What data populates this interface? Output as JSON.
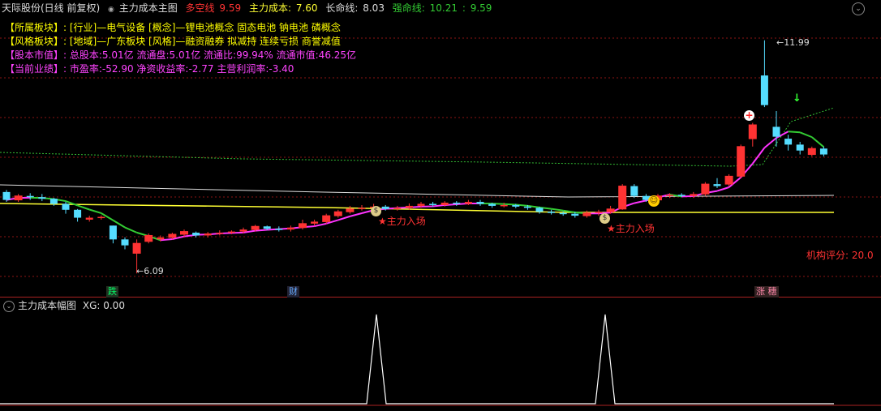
{
  "header": {
    "stock": "天际股份(日线 前复权)",
    "indicator_name": "主力成本主图",
    "multi_label": "多空线",
    "multi_value": "9.59",
    "cost_label": "主力成本:",
    "cost_value": "7.60",
    "life_label": "长命线:",
    "life_value": "8.03",
    "strong_label": "强命线:",
    "strong_value": "10.21",
    "strong_sep": ":",
    "strong_value2": "9.59"
  },
  "info": [
    {
      "label": "【所属板块】:",
      "text": "[行业]—电气设备 [概念]—锂电池概念 固态电池 钠电池 磷概念",
      "color": "#ffff00"
    },
    {
      "label": "【风格板块】:",
      "text": "[地域]—广东板块 [风格]—融资融券 拟减持 连续亏损 商誉减值",
      "color": "#ffff00"
    },
    {
      "label": "【股本市值】:",
      "text": "总股本:5.01亿 流通盘:5.01亿 流通比:99.94% 流通市值:46.25亿",
      "color": "#ff44ff"
    },
    {
      "label": "【当前业绩】:",
      "text": "市盈率:-52.90 净资收益率:-2.77 主营利润率:-3.40",
      "color": "#ff44ff"
    }
  ],
  "annotations": {
    "high": "11.99",
    "low": "6.09",
    "entry1": "主力入场",
    "entry2": "主力入场",
    "score": "机构评分: 20.0"
  },
  "bottom_markers": [
    {
      "text": "跌",
      "color": "#00ff66",
      "bg": "#223322"
    },
    {
      "text": "财",
      "color": "#66aaff",
      "bg": "#222233"
    },
    {
      "text": "涨 穗",
      "color": "#ff88aa",
      "bg": "#332222"
    }
  ],
  "sub_chart": {
    "title": "主力成本幅图",
    "xg_label": "XG:",
    "xg_value": "0.00"
  },
  "colors": {
    "up": "#ff3333",
    "down": "#55ddff",
    "ma_green": "#33cc33",
    "ma_magenta": "#ff33ff",
    "yellow": "#ffff33",
    "white": "#dddddd"
  },
  "chart_data": {
    "type": "candlestick",
    "ylim": [
      5.5,
      12.6
    ],
    "candles": [
      {
        "o": 8.15,
        "c": 7.95,
        "h": 8.2,
        "l": 7.9
      },
      {
        "o": 7.95,
        "c": 8.05,
        "h": 8.1,
        "l": 7.9
      },
      {
        "o": 8.05,
        "c": 8.02,
        "h": 8.12,
        "l": 7.95
      },
      {
        "o": 8.02,
        "c": 7.98,
        "h": 8.1,
        "l": 7.92
      },
      {
        "o": 7.98,
        "c": 7.85,
        "h": 8.0,
        "l": 7.8
      },
      {
        "o": 7.85,
        "c": 7.7,
        "h": 7.9,
        "l": 7.6
      },
      {
        "o": 7.7,
        "c": 7.5,
        "h": 7.72,
        "l": 7.4
      },
      {
        "o": 7.45,
        "c": 7.5,
        "h": 7.55,
        "l": 7.4
      },
      {
        "o": 7.5,
        "c": 7.52,
        "h": 7.56,
        "l": 7.45
      },
      {
        "o": 7.3,
        "c": 6.95,
        "h": 7.3,
        "l": 6.85
      },
      {
        "o": 6.95,
        "c": 6.8,
        "h": 7.0,
        "l": 6.7
      },
      {
        "o": 6.6,
        "c": 6.85,
        "h": 6.95,
        "l": 6.09
      },
      {
        "o": 6.9,
        "c": 7.05,
        "h": 7.1,
        "l": 6.85
      },
      {
        "o": 6.95,
        "c": 7.0,
        "h": 7.05,
        "l": 6.9
      },
      {
        "o": 7.0,
        "c": 7.08,
        "h": 7.12,
        "l": 6.95
      },
      {
        "o": 7.08,
        "c": 7.15,
        "h": 7.2,
        "l": 7.0
      },
      {
        "o": 7.12,
        "c": 7.05,
        "h": 7.15,
        "l": 7.0
      },
      {
        "o": 7.05,
        "c": 7.1,
        "h": 7.14,
        "l": 7.0
      },
      {
        "o": 7.1,
        "c": 7.12,
        "h": 7.18,
        "l": 7.05
      },
      {
        "o": 7.12,
        "c": 7.15,
        "h": 7.18,
        "l": 7.08
      },
      {
        "o": 7.15,
        "c": 7.2,
        "h": 7.25,
        "l": 7.1
      },
      {
        "o": 7.2,
        "c": 7.28,
        "h": 7.32,
        "l": 7.15
      },
      {
        "o": 7.28,
        "c": 7.22,
        "h": 7.3,
        "l": 7.18
      },
      {
        "o": 7.22,
        "c": 7.2,
        "h": 7.28,
        "l": 7.15
      },
      {
        "o": 7.2,
        "c": 7.25,
        "h": 7.3,
        "l": 7.15
      },
      {
        "o": 7.25,
        "c": 7.35,
        "h": 7.45,
        "l": 7.2
      },
      {
        "o": 7.35,
        "c": 7.4,
        "h": 7.45,
        "l": 7.3
      },
      {
        "o": 7.4,
        "c": 7.55,
        "h": 7.6,
        "l": 7.35
      },
      {
        "o": 7.55,
        "c": 7.65,
        "h": 7.7,
        "l": 7.5
      },
      {
        "o": 7.65,
        "c": 7.72,
        "h": 7.8,
        "l": 7.6
      },
      {
        "o": 7.72,
        "c": 7.75,
        "h": 7.82,
        "l": 7.68
      },
      {
        "o": 7.75,
        "c": 7.78,
        "h": 7.85,
        "l": 7.7
      },
      {
        "o": 7.78,
        "c": 7.72,
        "h": 7.82,
        "l": 7.68
      },
      {
        "o": 7.72,
        "c": 7.75,
        "h": 7.8,
        "l": 7.68
      },
      {
        "o": 7.75,
        "c": 7.8,
        "h": 7.86,
        "l": 7.7
      },
      {
        "o": 7.8,
        "c": 7.85,
        "h": 7.9,
        "l": 7.75
      },
      {
        "o": 7.85,
        "c": 7.82,
        "h": 7.9,
        "l": 7.78
      },
      {
        "o": 7.82,
        "c": 7.88,
        "h": 7.92,
        "l": 7.78
      },
      {
        "o": 7.88,
        "c": 7.85,
        "h": 7.92,
        "l": 7.8
      },
      {
        "o": 7.85,
        "c": 7.9,
        "h": 7.95,
        "l": 7.82
      },
      {
        "o": 7.9,
        "c": 7.85,
        "h": 7.95,
        "l": 7.8
      },
      {
        "o": 7.85,
        "c": 7.8,
        "h": 7.88,
        "l": 7.75
      },
      {
        "o": 7.8,
        "c": 7.82,
        "h": 7.88,
        "l": 7.76
      },
      {
        "o": 7.82,
        "c": 7.78,
        "h": 7.85,
        "l": 7.74
      },
      {
        "o": 7.78,
        "c": 7.75,
        "h": 7.82,
        "l": 7.7
      },
      {
        "o": 7.75,
        "c": 7.65,
        "h": 7.78,
        "l": 7.6
      },
      {
        "o": 7.65,
        "c": 7.62,
        "h": 7.7,
        "l": 7.58
      },
      {
        "o": 7.62,
        "c": 7.6,
        "h": 7.66,
        "l": 7.55
      },
      {
        "o": 7.6,
        "c": 7.55,
        "h": 7.65,
        "l": 7.5
      },
      {
        "o": 7.55,
        "c": 7.62,
        "h": 7.68,
        "l": 7.5
      },
      {
        "o": 7.62,
        "c": 7.65,
        "h": 7.7,
        "l": 7.55
      },
      {
        "o": 7.65,
        "c": 7.72,
        "h": 7.8,
        "l": 7.6
      },
      {
        "o": 7.72,
        "c": 8.3,
        "h": 8.35,
        "l": 7.7
      },
      {
        "o": 8.3,
        "c": 8.05,
        "h": 8.35,
        "l": 8.0
      },
      {
        "o": 8.05,
        "c": 7.95,
        "h": 8.1,
        "l": 7.9
      },
      {
        "o": 7.95,
        "c": 8.05,
        "h": 8.1,
        "l": 7.92
      },
      {
        "o": 8.05,
        "c": 8.08,
        "h": 8.12,
        "l": 8.0
      },
      {
        "o": 8.08,
        "c": 8.05,
        "h": 8.12,
        "l": 8.02
      },
      {
        "o": 8.05,
        "c": 8.1,
        "h": 8.15,
        "l": 8.0
      },
      {
        "o": 8.1,
        "c": 8.35,
        "h": 8.4,
        "l": 8.05
      },
      {
        "o": 8.35,
        "c": 8.3,
        "h": 8.5,
        "l": 8.25
      },
      {
        "o": 8.35,
        "c": 8.55,
        "h": 8.6,
        "l": 8.3
      },
      {
        "o": 8.55,
        "c": 9.3,
        "h": 9.35,
        "l": 8.5
      },
      {
        "o": 9.5,
        "c": 9.85,
        "h": 9.9,
        "l": 9.3
      },
      {
        "o": 11.1,
        "c": 10.35,
        "h": 11.99,
        "l": 10.3
      },
      {
        "o": 9.8,
        "c": 9.55,
        "h": 10.2,
        "l": 9.3
      },
      {
        "o": 9.5,
        "c": 9.35,
        "h": 9.6,
        "l": 9.2
      },
      {
        "o": 9.35,
        "c": 9.2,
        "h": 9.42,
        "l": 9.1
      },
      {
        "o": 9.1,
        "c": 9.25,
        "h": 9.3,
        "l": 9.05
      },
      {
        "o": 9.25,
        "c": 9.1,
        "h": 9.3,
        "l": 9.05
      }
    ]
  }
}
